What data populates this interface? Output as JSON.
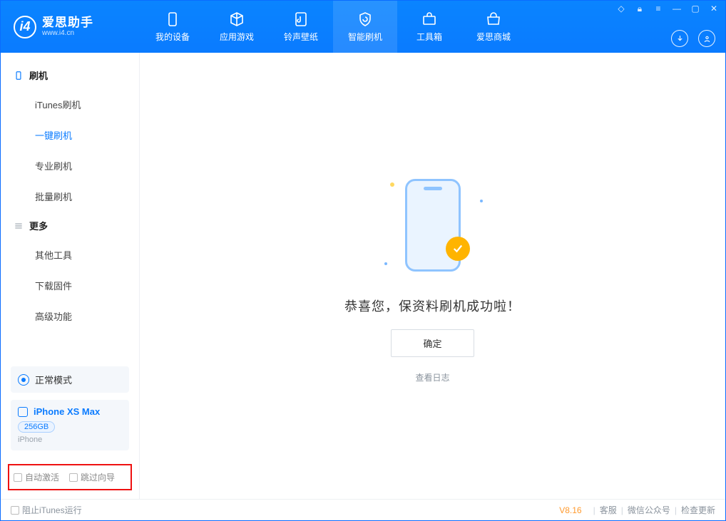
{
  "app": {
    "name_cn": "爱思助手",
    "name_en": "www.i4.cn"
  },
  "nav": {
    "items": [
      {
        "label": "我的设备"
      },
      {
        "label": "应用游戏"
      },
      {
        "label": "铃声壁纸"
      },
      {
        "label": "智能刷机"
      },
      {
        "label": "工具箱"
      },
      {
        "label": "爱思商城"
      }
    ],
    "active_index": 3
  },
  "sidebar": {
    "groups": [
      {
        "title": "刷机",
        "items": [
          "iTunes刷机",
          "一键刷机",
          "专业刷机",
          "批量刷机"
        ],
        "active_index": 1
      },
      {
        "title": "更多",
        "items": [
          "其他工具",
          "下载固件",
          "高级功能"
        ],
        "active_index": -1
      }
    ],
    "mode_label": "正常模式",
    "device": {
      "name": "iPhone XS Max",
      "capacity": "256GB",
      "type": "iPhone"
    },
    "options": {
      "auto_activate": "自动激活",
      "skip_guide": "跳过向导"
    }
  },
  "main": {
    "success_message": "恭喜您，保资料刷机成功啦！",
    "ok_button": "确定",
    "view_log": "查看日志"
  },
  "footer": {
    "block_itunes": "阻止iTunes运行",
    "version": "V8.16",
    "links": [
      "客服",
      "微信公众号",
      "检查更新"
    ]
  }
}
